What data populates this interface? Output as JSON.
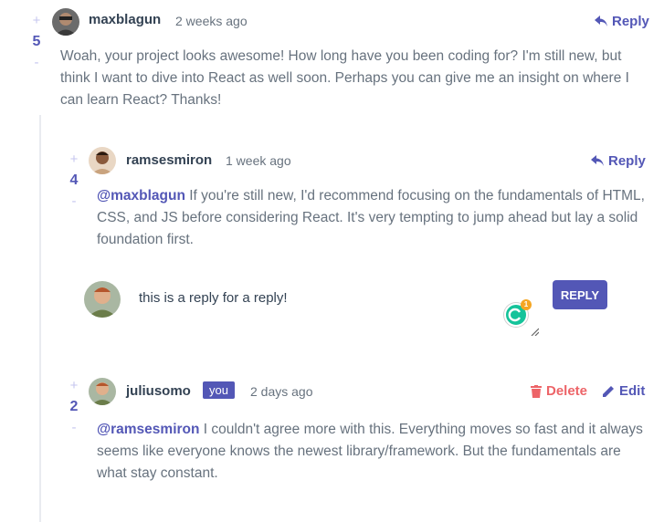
{
  "comments": [
    {
      "score": "5",
      "username": "maxblagun",
      "time": "2 weeks ago",
      "reply_label": "Reply",
      "text": "Woah, your project looks awesome! How long have you been coding for? I'm still new, but think I want to dive into React as well soon. Perhaps you can give me an insight on where I can learn React? Thanks!"
    },
    {
      "score": "4",
      "username": "ramsesmiron",
      "time": "1 week ago",
      "reply_label": "Reply",
      "mention": "@maxblagun",
      "text": " If you're still new, I'd recommend focusing on the fundamentals of HTML, CSS, and JS before considering React. It's very tempting to jump ahead but lay a solid foundation first."
    },
    {
      "score": "2",
      "username": "juliusomo",
      "you_badge": "you",
      "time": "2 days ago",
      "delete_label": "Delete",
      "edit_label": "Edit",
      "mention": "@ramsesmiron",
      "text": " I couldn't agree more with this. Everything moves so fast and it always seems like everyone knows the newest library/framework. But the fundamentals are what stay constant."
    }
  ],
  "reply_form": {
    "value": "this is a reply for a reply!",
    "button_label": "REPLY",
    "grammarly_badge": "1"
  },
  "vote_symbols": {
    "plus": "+",
    "minus": "-"
  }
}
